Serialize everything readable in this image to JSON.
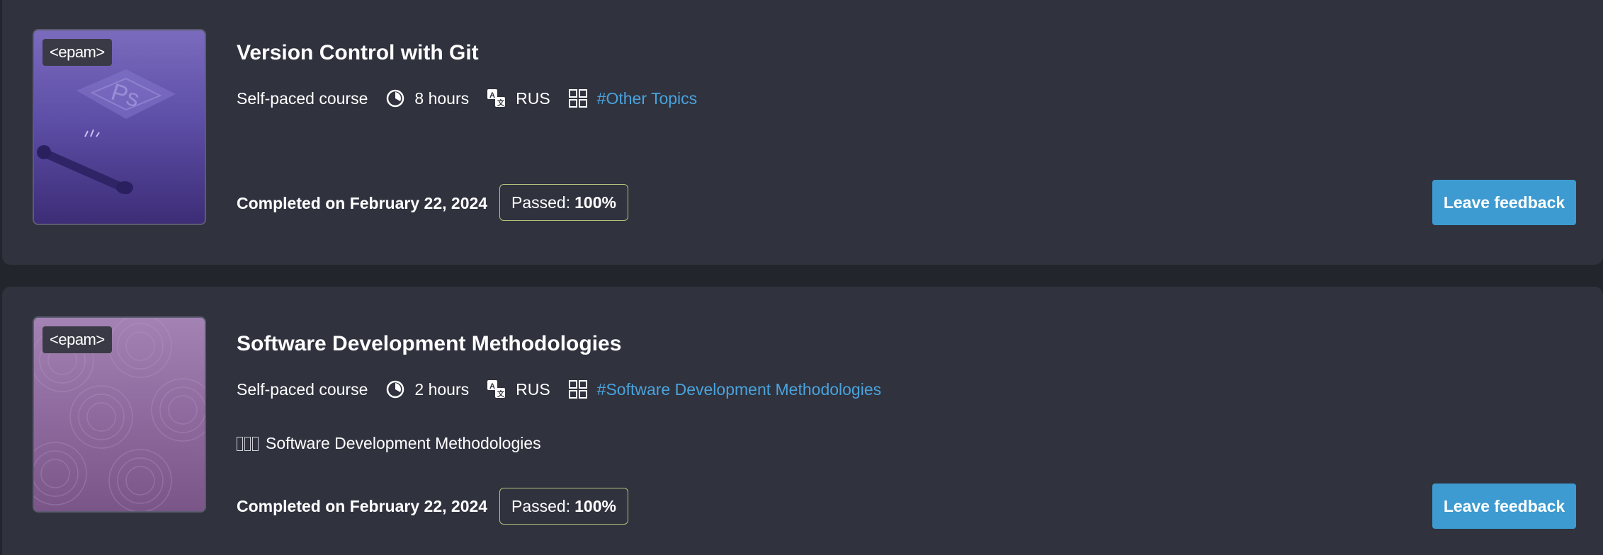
{
  "courses": [
    {
      "title": "Version Control with Git",
      "badge": "<epam>",
      "type": "Self-paced course",
      "duration": "8 hours",
      "language": "RUS",
      "tag": "#Other Topics",
      "description": "",
      "completed": "Completed on February 22, 2024",
      "passed_label": "Passed:",
      "passed_value": "100%",
      "feedback_label": "Leave feedback",
      "thumb_icon": "photoshop-pen-icon"
    },
    {
      "title": "Software Development Methodologies",
      "badge": "<epam>",
      "type": "Self-paced course",
      "duration": "2 hours",
      "language": "RUS",
      "tag": "#Software Development Methodologies",
      "description": "Software Development Methodologies",
      "completed": "Completed on February 22, 2024",
      "passed_label": "Passed:",
      "passed_value": "100%",
      "feedback_label": "Leave feedback",
      "thumb_icon": "swirl-pattern-icon"
    }
  ],
  "icons": {
    "duration": "clock-icon",
    "language": "translate-icon",
    "tag": "category-grid-icon"
  },
  "colors": {
    "page_bg": "#23252d",
    "card_bg": "#30323e",
    "link": "#4aa3dc",
    "button": "#3d9bd1",
    "passed_border": "#b6c47a"
  }
}
